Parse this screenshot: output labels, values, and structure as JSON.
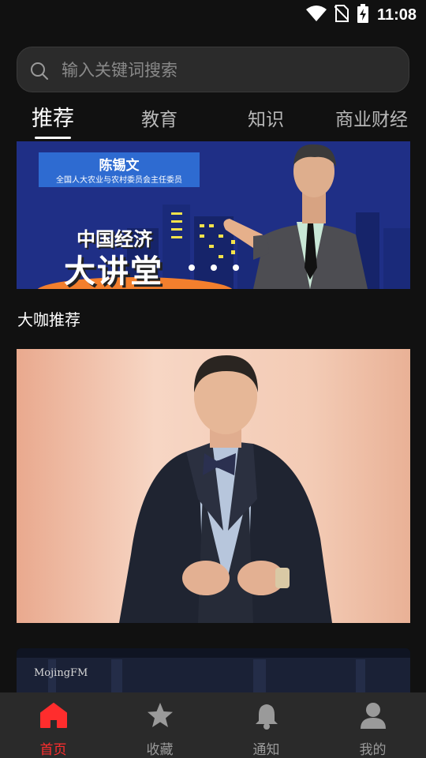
{
  "status_bar": {
    "time": "11:08",
    "icons": [
      "wifi-icon",
      "no-sim-icon",
      "battery-charging-icon"
    ]
  },
  "search": {
    "placeholder": "输入关键词搜索",
    "value": ""
  },
  "tabs": [
    {
      "label": "推荐",
      "active": true
    },
    {
      "label": "教育",
      "active": false
    },
    {
      "label": "知识",
      "active": false
    },
    {
      "label": "商业财经",
      "active": false
    }
  ],
  "banner": {
    "speaker_name": "陈锡文",
    "speaker_title": "全国人大农业与农村委员会主任委员",
    "program_line1": "中国经济",
    "program_line2": "大讲堂"
  },
  "section": {
    "title": "大咖推荐"
  },
  "bottom_card": {
    "brand": "MojingFM"
  },
  "bottom_nav": [
    {
      "label": "首页",
      "icon": "home-icon",
      "active": true
    },
    {
      "label": "收藏",
      "icon": "star-icon",
      "active": false
    },
    {
      "label": "通知",
      "icon": "bell-icon",
      "active": false
    },
    {
      "label": "我的",
      "icon": "person-icon",
      "active": false
    }
  ],
  "colors": {
    "background": "#111111",
    "accent": "#ff2d2d",
    "nav_background": "#2a2a2a",
    "banner_blue": "#1f2f86"
  }
}
